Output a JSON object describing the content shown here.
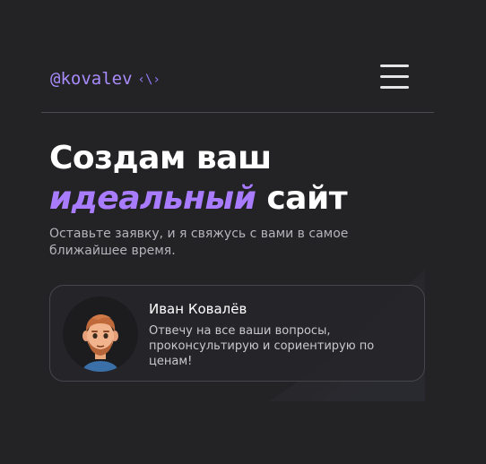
{
  "header": {
    "logo_text": "@kovalev",
    "logo_code": "‹\\›",
    "menu_icon": "hamburger-menu-icon"
  },
  "hero": {
    "title_line1": "Создам ваш",
    "title_accent": "идеальный",
    "title_rest": " сайт",
    "subtitle": "Оставьте заявку, и я свяжусь с вами в самое ближайшее время."
  },
  "contact_card": {
    "name": "Иван Ковалёв",
    "message": "Отвечу на все ваши вопросы, проконсультирую и сориентирую по ценам!",
    "avatar_icon": "memoji-avatar-icon"
  },
  "colors": {
    "background": "#232326",
    "accent": "#a97cff",
    "text": "#ffffff",
    "muted": "#b4b4ba"
  }
}
